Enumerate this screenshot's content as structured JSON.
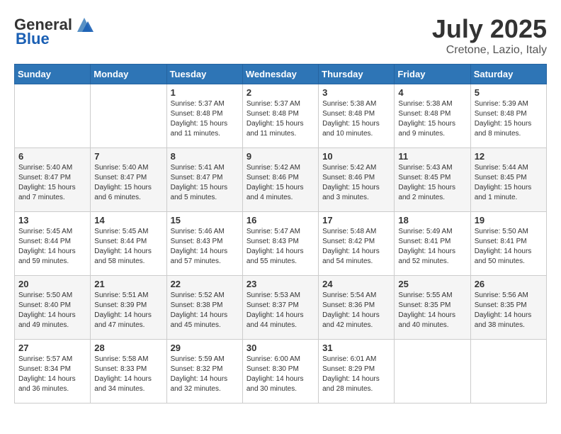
{
  "logo": {
    "general": "General",
    "blue": "Blue"
  },
  "header": {
    "month_year": "July 2025",
    "location": "Cretone, Lazio, Italy"
  },
  "days_of_week": [
    "Sunday",
    "Monday",
    "Tuesday",
    "Wednesday",
    "Thursday",
    "Friday",
    "Saturday"
  ],
  "weeks": [
    [
      {
        "day": "",
        "info": ""
      },
      {
        "day": "",
        "info": ""
      },
      {
        "day": "1",
        "info": "Sunrise: 5:37 AM\nSunset: 8:48 PM\nDaylight: 15 hours and 11 minutes."
      },
      {
        "day": "2",
        "info": "Sunrise: 5:37 AM\nSunset: 8:48 PM\nDaylight: 15 hours and 11 minutes."
      },
      {
        "day": "3",
        "info": "Sunrise: 5:38 AM\nSunset: 8:48 PM\nDaylight: 15 hours and 10 minutes."
      },
      {
        "day": "4",
        "info": "Sunrise: 5:38 AM\nSunset: 8:48 PM\nDaylight: 15 hours and 9 minutes."
      },
      {
        "day": "5",
        "info": "Sunrise: 5:39 AM\nSunset: 8:48 PM\nDaylight: 15 hours and 8 minutes."
      }
    ],
    [
      {
        "day": "6",
        "info": "Sunrise: 5:40 AM\nSunset: 8:47 PM\nDaylight: 15 hours and 7 minutes."
      },
      {
        "day": "7",
        "info": "Sunrise: 5:40 AM\nSunset: 8:47 PM\nDaylight: 15 hours and 6 minutes."
      },
      {
        "day": "8",
        "info": "Sunrise: 5:41 AM\nSunset: 8:47 PM\nDaylight: 15 hours and 5 minutes."
      },
      {
        "day": "9",
        "info": "Sunrise: 5:42 AM\nSunset: 8:46 PM\nDaylight: 15 hours and 4 minutes."
      },
      {
        "day": "10",
        "info": "Sunrise: 5:42 AM\nSunset: 8:46 PM\nDaylight: 15 hours and 3 minutes."
      },
      {
        "day": "11",
        "info": "Sunrise: 5:43 AM\nSunset: 8:45 PM\nDaylight: 15 hours and 2 minutes."
      },
      {
        "day": "12",
        "info": "Sunrise: 5:44 AM\nSunset: 8:45 PM\nDaylight: 15 hours and 1 minute."
      }
    ],
    [
      {
        "day": "13",
        "info": "Sunrise: 5:45 AM\nSunset: 8:44 PM\nDaylight: 14 hours and 59 minutes."
      },
      {
        "day": "14",
        "info": "Sunrise: 5:45 AM\nSunset: 8:44 PM\nDaylight: 14 hours and 58 minutes."
      },
      {
        "day": "15",
        "info": "Sunrise: 5:46 AM\nSunset: 8:43 PM\nDaylight: 14 hours and 57 minutes."
      },
      {
        "day": "16",
        "info": "Sunrise: 5:47 AM\nSunset: 8:43 PM\nDaylight: 14 hours and 55 minutes."
      },
      {
        "day": "17",
        "info": "Sunrise: 5:48 AM\nSunset: 8:42 PM\nDaylight: 14 hours and 54 minutes."
      },
      {
        "day": "18",
        "info": "Sunrise: 5:49 AM\nSunset: 8:41 PM\nDaylight: 14 hours and 52 minutes."
      },
      {
        "day": "19",
        "info": "Sunrise: 5:50 AM\nSunset: 8:41 PM\nDaylight: 14 hours and 50 minutes."
      }
    ],
    [
      {
        "day": "20",
        "info": "Sunrise: 5:50 AM\nSunset: 8:40 PM\nDaylight: 14 hours and 49 minutes."
      },
      {
        "day": "21",
        "info": "Sunrise: 5:51 AM\nSunset: 8:39 PM\nDaylight: 14 hours and 47 minutes."
      },
      {
        "day": "22",
        "info": "Sunrise: 5:52 AM\nSunset: 8:38 PM\nDaylight: 14 hours and 45 minutes."
      },
      {
        "day": "23",
        "info": "Sunrise: 5:53 AM\nSunset: 8:37 PM\nDaylight: 14 hours and 44 minutes."
      },
      {
        "day": "24",
        "info": "Sunrise: 5:54 AM\nSunset: 8:36 PM\nDaylight: 14 hours and 42 minutes."
      },
      {
        "day": "25",
        "info": "Sunrise: 5:55 AM\nSunset: 8:35 PM\nDaylight: 14 hours and 40 minutes."
      },
      {
        "day": "26",
        "info": "Sunrise: 5:56 AM\nSunset: 8:35 PM\nDaylight: 14 hours and 38 minutes."
      }
    ],
    [
      {
        "day": "27",
        "info": "Sunrise: 5:57 AM\nSunset: 8:34 PM\nDaylight: 14 hours and 36 minutes."
      },
      {
        "day": "28",
        "info": "Sunrise: 5:58 AM\nSunset: 8:33 PM\nDaylight: 14 hours and 34 minutes."
      },
      {
        "day": "29",
        "info": "Sunrise: 5:59 AM\nSunset: 8:32 PM\nDaylight: 14 hours and 32 minutes."
      },
      {
        "day": "30",
        "info": "Sunrise: 6:00 AM\nSunset: 8:30 PM\nDaylight: 14 hours and 30 minutes."
      },
      {
        "day": "31",
        "info": "Sunrise: 6:01 AM\nSunset: 8:29 PM\nDaylight: 14 hours and 28 minutes."
      },
      {
        "day": "",
        "info": ""
      },
      {
        "day": "",
        "info": ""
      }
    ]
  ]
}
